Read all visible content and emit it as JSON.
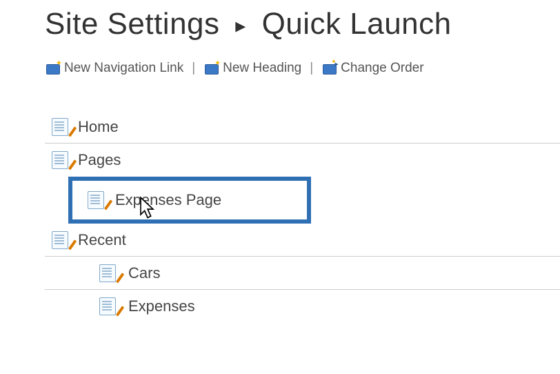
{
  "breadcrumb": {
    "parent": "Site Settings",
    "current": "Quick Launch"
  },
  "toolbar": {
    "new_link_label": "New Navigation Link",
    "new_heading_label": "New Heading",
    "change_order_label": "Change Order",
    "separator": "|"
  },
  "nav": {
    "items": [
      {
        "label": "Home",
        "level": 0
      },
      {
        "label": "Pages",
        "level": 0
      },
      {
        "label": "Expenses Page",
        "level": 1,
        "highlighted": true
      },
      {
        "label": "Recent",
        "level": 0
      },
      {
        "label": "Cars",
        "level": 1
      },
      {
        "label": "Expenses",
        "level": 1
      }
    ]
  }
}
